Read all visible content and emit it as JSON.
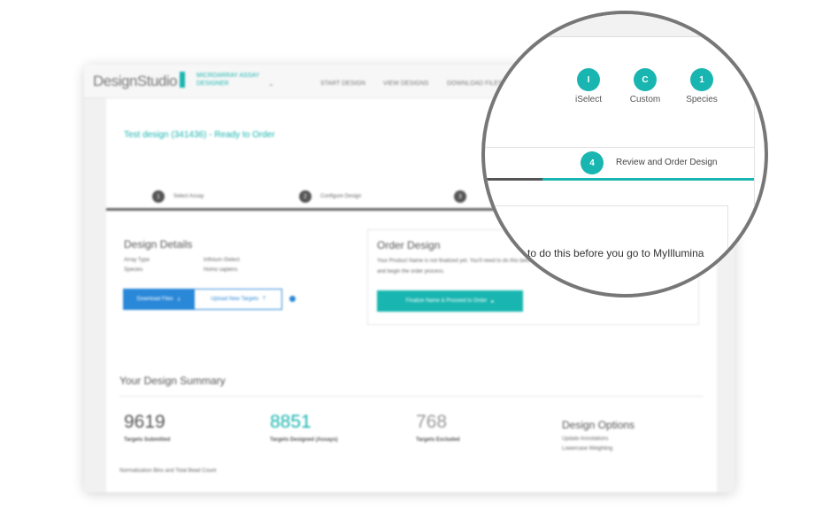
{
  "header": {
    "logo": "DesignStudio",
    "product": "MICROARRAY ASSAY DESIGNER",
    "nav": [
      "START DESIGN",
      "VIEW DESIGNS",
      "DOWNLOAD FILES"
    ]
  },
  "page": {
    "title": "Test design (341436) - Ready to Order"
  },
  "steps": [
    {
      "num": "1",
      "label": "Select Assay"
    },
    {
      "num": "2",
      "label": "Configure Design"
    },
    {
      "num": "3",
      "label": ""
    },
    {
      "num": "4",
      "label": "Review and Order Design"
    }
  ],
  "details": {
    "heading": "Design Details",
    "rows": [
      {
        "key": "Array Type",
        "value": "Infinium iSelect"
      },
      {
        "key": "Species",
        "value": "Homo sapiens"
      }
    ],
    "download": "Download Files",
    "upload": "Upload New Targets"
  },
  "order": {
    "heading": "Order Design",
    "text1": "Your Product Name is not finalized yet. You'll need to do this before you go to MyIllumina",
    "text2": "and begin the order process.",
    "button": "Finalize Name & Proceed to Order"
  },
  "summary": {
    "heading": "Your Design Summary",
    "stats": [
      {
        "value": "9619",
        "label": "Targets Submitted"
      },
      {
        "value": "8851",
        "label": "Targets Designed (Assays)"
      },
      {
        "value": "768",
        "label": "Targets Excluded"
      }
    ],
    "options_heading": "Design Options",
    "options": [
      "Update Annotations",
      "Lowercase Weighting"
    ],
    "norm": "Normalization Bins and Total Bead Count"
  },
  "badges": [
    {
      "letter": "I",
      "label": "iSelect"
    },
    {
      "letter": "C",
      "label": "Custom"
    },
    {
      "letter": "1",
      "label": "Species"
    }
  ],
  "magnified_text": "to do this before you go to MyIllumina",
  "colors": {
    "accent": "#19b5b0",
    "primary_button": "#2a88d8"
  }
}
